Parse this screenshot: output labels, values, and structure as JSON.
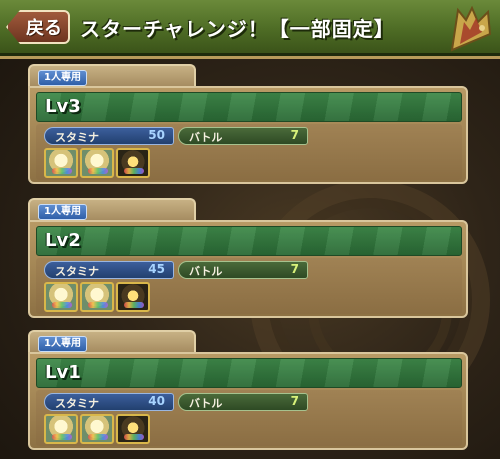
{
  "header": {
    "back_label": "戻る",
    "title": "スターチャレンジ！【一部固定】"
  },
  "dungeons": [
    {
      "badge": "1人専用",
      "level": "Lv3",
      "stamina_label": "スタミナ",
      "stamina": "50",
      "battle_label": "バトル",
      "battles": "7",
      "monsters": [
        "light-monster-icon",
        "light-monster-icon",
        "dark-monster-icon"
      ]
    },
    {
      "badge": "1人専用",
      "level": "Lv2",
      "stamina_label": "スタミナ",
      "stamina": "45",
      "battle_label": "バトル",
      "battles": "7",
      "monsters": [
        "light-monster-icon",
        "light-monster-icon",
        "dark-monster-icon"
      ]
    },
    {
      "badge": "1人専用",
      "level": "Lv1",
      "stamina_label": "スタミナ",
      "stamina": "40",
      "battle_label": "バトル",
      "battles": "7",
      "monsters": [
        "light-monster-icon",
        "light-monster-icon",
        "dark-monster-icon"
      ]
    }
  ],
  "colors": {
    "header_green": "#4e6c25",
    "band_green": "#3f8a4a",
    "stamina_blue": "#22406f",
    "panel_tan": "#b89a65"
  }
}
